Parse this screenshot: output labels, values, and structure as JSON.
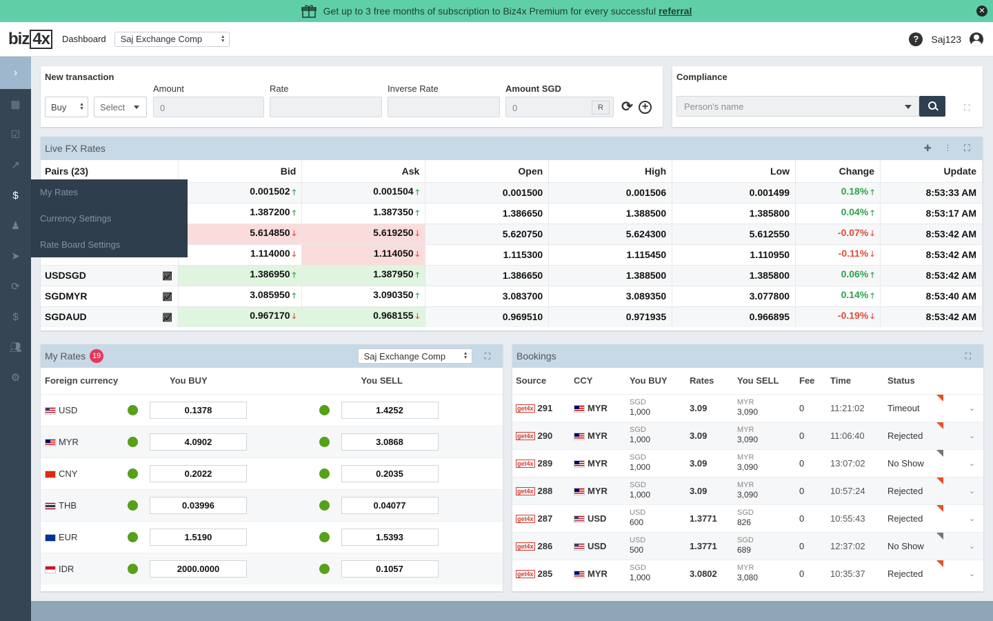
{
  "banner": {
    "text": "Get up to 3 free months of subscription to Biz4x Premium for every successful",
    "link": "referral",
    "close": "✕"
  },
  "header": {
    "logo_a": "biz",
    "logo_b": "4x",
    "dashboard": "Dashboard",
    "company": "Saj Exchange Comp",
    "user": "Saj123",
    "help": "?"
  },
  "sidebar": {
    "toggle": "›",
    "flyout": [
      "My Rates",
      "Currency Settings",
      "Rate Board Settings"
    ]
  },
  "newtx": {
    "title": "New transaction",
    "side": "Buy",
    "select": "Select",
    "amount_label": "Amount",
    "amount": "0",
    "rate_label": "Rate",
    "inverse_label": "Inverse Rate",
    "sgd_label": "Amount SGD",
    "sgd": "0",
    "r": "R"
  },
  "compliance": {
    "title": "Compliance",
    "placeholder": "Person's name"
  },
  "fx": {
    "title": "Live FX Rates",
    "headers": [
      "Pairs (23)",
      "Bid",
      "Ask",
      "Open",
      "High",
      "Low",
      "Change",
      "Update"
    ],
    "rows": [
      {
        "pair": "",
        "bid": "0.001502",
        "bd": "up",
        "ask": "0.001504",
        "ad": "up",
        "open": "0.001500",
        "high": "0.001506",
        "low": "0.001499",
        "chg": "0.18%",
        "cd": "up",
        "upd": "8:53:33 AM",
        "bg": [
          "",
          ""
        ]
      },
      {
        "pair": "",
        "bid": "1.387200",
        "bd": "up",
        "ask": "1.387350",
        "ad": "up",
        "open": "1.386650",
        "high": "1.388500",
        "low": "1.385800",
        "chg": "0.04%",
        "cd": "up",
        "upd": "8:53:17 AM",
        "bg": [
          "",
          ""
        ]
      },
      {
        "pair": "",
        "bid": "5.614850",
        "bd": "dn",
        "ask": "5.619250",
        "ad": "dn",
        "open": "5.620750",
        "high": "5.624300",
        "low": "5.612550",
        "chg": "-0.07%",
        "cd": "dn",
        "upd": "8:53:42 AM",
        "bg": [
          "red",
          "red"
        ]
      },
      {
        "pair": "",
        "bid": "1.114000",
        "bd": "dn",
        "ask": "1.114050",
        "ad": "dn",
        "open": "1.115300",
        "high": "1.115450",
        "low": "1.110950",
        "chg": "-0.11%",
        "cd": "dn",
        "upd": "8:53:42 AM",
        "bg": [
          "",
          "red"
        ]
      },
      {
        "pair": "USDSGD",
        "bid": "1.386950",
        "bd": "up",
        "ask": "1.387950",
        "ad": "up",
        "open": "1.386650",
        "high": "1.388500",
        "low": "1.385800",
        "chg": "0.06%",
        "cd": "up",
        "upd": "8:53:42 AM",
        "bg": [
          "green",
          "green"
        ]
      },
      {
        "pair": "SGDMYR",
        "bid": "3.085950",
        "bd": "up",
        "ask": "3.090350",
        "ad": "up",
        "open": "3.083700",
        "high": "3.089350",
        "low": "3.077800",
        "chg": "0.14%",
        "cd": "up",
        "upd": "8:53:40 AM",
        "bg": [
          "",
          ""
        ]
      },
      {
        "pair": "SGDAUD",
        "bid": "0.967170",
        "bd": "dn",
        "ask": "0.968155",
        "ad": "dn",
        "open": "0.969510",
        "high": "0.971935",
        "low": "0.966895",
        "chg": "-0.19%",
        "cd": "dn",
        "upd": "8:53:42 AM",
        "bg": [
          "green",
          "green"
        ]
      }
    ]
  },
  "myrates": {
    "title": "My Rates",
    "badge": "19",
    "company": "Saj Exchange Comp",
    "headers": [
      "Foreign currency",
      "You BUY",
      "You SELL"
    ],
    "rows": [
      {
        "cur": "USD",
        "flag": "us",
        "buy": "0.1378",
        "sell": "1.4252"
      },
      {
        "cur": "MYR",
        "flag": "my",
        "buy": "4.0902",
        "sell": "3.0868"
      },
      {
        "cur": "CNY",
        "flag": "cn",
        "buy": "0.2022",
        "sell": "0.2035"
      },
      {
        "cur": "THB",
        "flag": "th",
        "buy": "0.03996",
        "sell": "0.04077"
      },
      {
        "cur": "EUR",
        "flag": "eu",
        "buy": "1.5190",
        "sell": "1.5393"
      },
      {
        "cur": "IDR",
        "flag": "id",
        "buy": "2000.0000",
        "sell": "0.1057"
      }
    ]
  },
  "bookings": {
    "title": "Bookings",
    "headers": [
      "Source",
      "CCY",
      "You BUY",
      "Rates",
      "You SELL",
      "Fee",
      "Time",
      "Status"
    ],
    "rows": [
      {
        "id": "291",
        "ccy": "MYR",
        "flag": "my",
        "bcur": "SGD",
        "bamt": "1,000",
        "rate": "3.09",
        "scur": "MYR",
        "samt": "3,090",
        "fee": "0",
        "time": "11:21:02",
        "status": "Timeout",
        "corner": "red"
      },
      {
        "id": "290",
        "ccy": "MYR",
        "flag": "my",
        "bcur": "SGD",
        "bamt": "1,000",
        "rate": "3.09",
        "scur": "MYR",
        "samt": "3,090",
        "fee": "0",
        "time": "11:06:40",
        "status": "Rejected",
        "corner": "red"
      },
      {
        "id": "289",
        "ccy": "MYR",
        "flag": "my",
        "bcur": "SGD",
        "bamt": "1,000",
        "rate": "3.09",
        "scur": "MYR",
        "samt": "3,090",
        "fee": "0",
        "time": "13:07:02",
        "status": "No Show",
        "corner": "grey"
      },
      {
        "id": "288",
        "ccy": "MYR",
        "flag": "my",
        "bcur": "SGD",
        "bamt": "1,000",
        "rate": "3.09",
        "scur": "MYR",
        "samt": "3,090",
        "fee": "0",
        "time": "10:57:24",
        "status": "Rejected",
        "corner": "red"
      },
      {
        "id": "287",
        "ccy": "USD",
        "flag": "us",
        "bcur": "USD",
        "bamt": "600",
        "rate": "1.3771",
        "scur": "SGD",
        "samt": "826",
        "fee": "0",
        "time": "10:55:43",
        "status": "Rejected",
        "corner": "red"
      },
      {
        "id": "286",
        "ccy": "USD",
        "flag": "us",
        "bcur": "USD",
        "bamt": "500",
        "rate": "1.3771",
        "scur": "SGD",
        "samt": "689",
        "fee": "0",
        "time": "12:37:02",
        "status": "No Show",
        "corner": "grey"
      },
      {
        "id": "285",
        "ccy": "MYR",
        "flag": "my",
        "bcur": "SGD",
        "bamt": "1,000",
        "rate": "3.0802",
        "scur": "MYR",
        "samt": "3,080",
        "fee": "0",
        "time": "10:35:37",
        "status": "Rejected",
        "corner": "red"
      }
    ]
  }
}
